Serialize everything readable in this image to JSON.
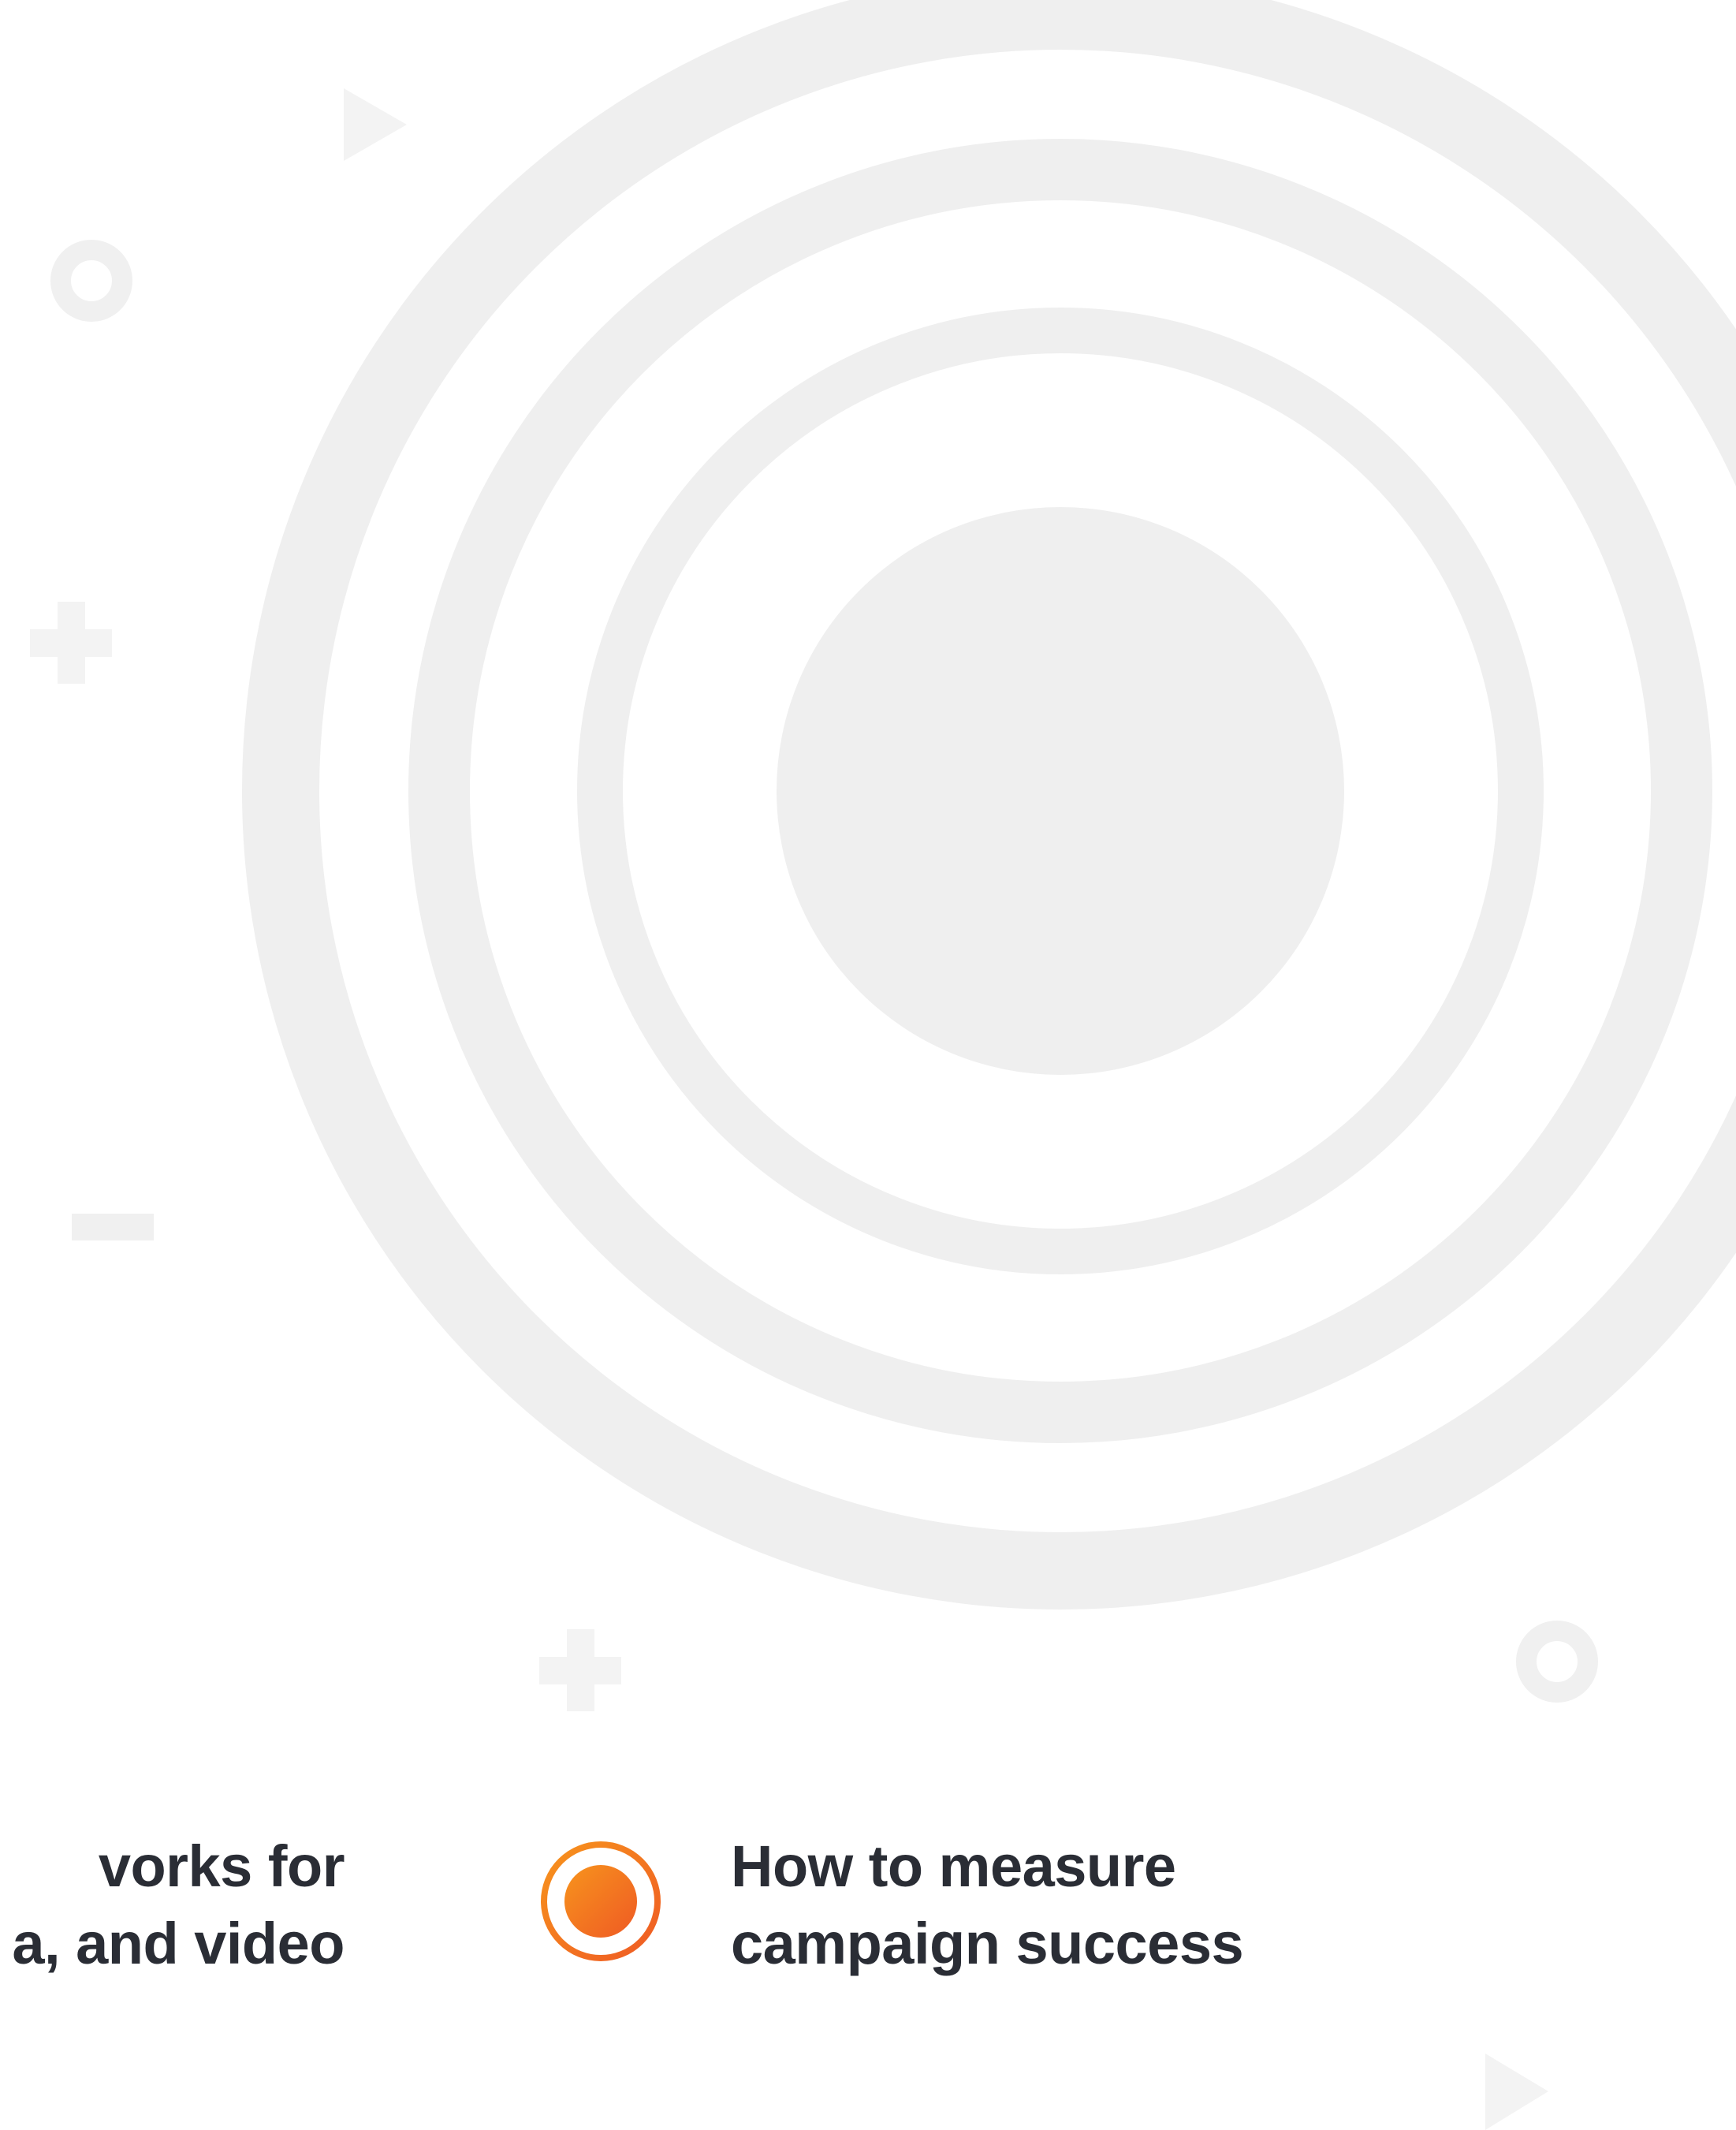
{
  "colors": {
    "background": "#ffffff",
    "ring": "#efefef",
    "decoration": "#f3f3f3",
    "text": "#2a2d35",
    "accent_start": "#f7941d",
    "accent_end": "#ef5a24"
  },
  "icons": {
    "bullet": "target-bullet-icon",
    "decorations": [
      "triangle-icon",
      "ring-icon",
      "plus-icon",
      "minus-icon"
    ]
  },
  "captions": {
    "left": {
      "line1": "vorks for",
      "line2": "a, and video"
    },
    "right": {
      "line1": "How to measure",
      "line2": "campaign success"
    }
  }
}
